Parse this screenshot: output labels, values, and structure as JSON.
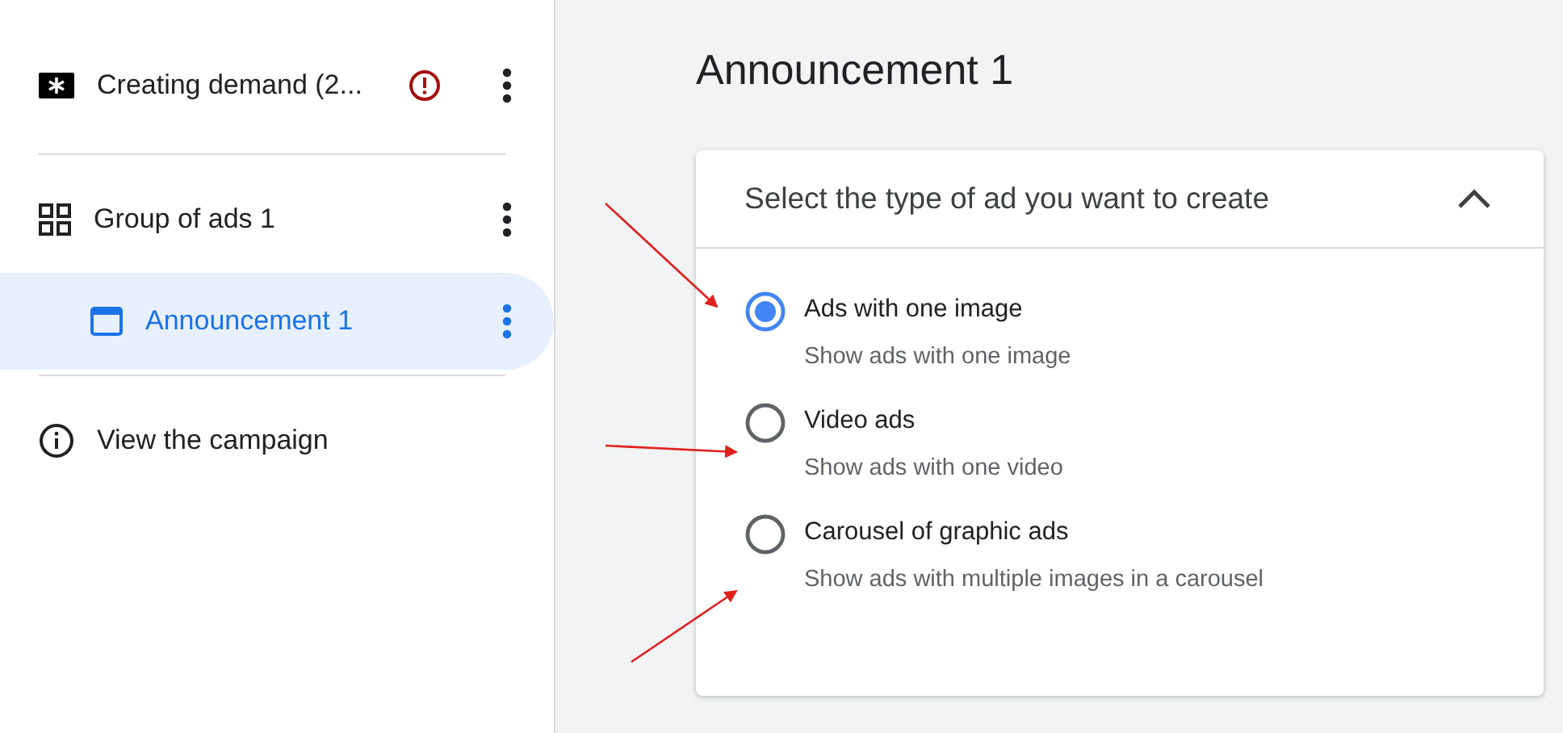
{
  "sidebar": {
    "items": [
      {
        "kind": "campaign",
        "label": "Creating demand (2...",
        "warning": true,
        "menu": true,
        "selected": false
      },
      {
        "kind": "group",
        "label": "Group of ads 1",
        "warning": false,
        "menu": true,
        "selected": false
      },
      {
        "kind": "ad",
        "label": "Announcement 1",
        "warning": false,
        "menu": true,
        "selected": true
      },
      {
        "kind": "link",
        "label": "View the campaign",
        "warning": false,
        "menu": false,
        "selected": false
      }
    ]
  },
  "main": {
    "title": "Announcement 1",
    "panel": {
      "heading": "Select the type of ad you want to create",
      "expanded": true,
      "options": [
        {
          "label": "Ads with one image",
          "description": "Show ads with one image",
          "selected": true
        },
        {
          "label": "Video ads",
          "description": "Show ads with one video",
          "selected": false
        },
        {
          "label": "Carousel of graphic ads",
          "description": "Show ads with multiple images in a carousel",
          "selected": false
        }
      ]
    }
  }
}
